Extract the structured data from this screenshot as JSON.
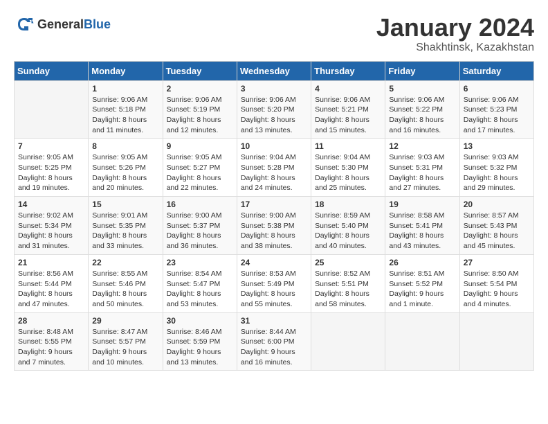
{
  "header": {
    "logo_general": "General",
    "logo_blue": "Blue",
    "title": "January 2024",
    "subtitle": "Shakhtinsk, Kazakhstan"
  },
  "days_of_week": [
    "Sunday",
    "Monday",
    "Tuesday",
    "Wednesday",
    "Thursday",
    "Friday",
    "Saturday"
  ],
  "weeks": [
    [
      {
        "day": "",
        "sunrise": "",
        "sunset": "",
        "daylight": ""
      },
      {
        "day": "1",
        "sunrise": "Sunrise: 9:06 AM",
        "sunset": "Sunset: 5:18 PM",
        "daylight": "Daylight: 8 hours and 11 minutes."
      },
      {
        "day": "2",
        "sunrise": "Sunrise: 9:06 AM",
        "sunset": "Sunset: 5:19 PM",
        "daylight": "Daylight: 8 hours and 12 minutes."
      },
      {
        "day": "3",
        "sunrise": "Sunrise: 9:06 AM",
        "sunset": "Sunset: 5:20 PM",
        "daylight": "Daylight: 8 hours and 13 minutes."
      },
      {
        "day": "4",
        "sunrise": "Sunrise: 9:06 AM",
        "sunset": "Sunset: 5:21 PM",
        "daylight": "Daylight: 8 hours and 15 minutes."
      },
      {
        "day": "5",
        "sunrise": "Sunrise: 9:06 AM",
        "sunset": "Sunset: 5:22 PM",
        "daylight": "Daylight: 8 hours and 16 minutes."
      },
      {
        "day": "6",
        "sunrise": "Sunrise: 9:06 AM",
        "sunset": "Sunset: 5:23 PM",
        "daylight": "Daylight: 8 hours and 17 minutes."
      }
    ],
    [
      {
        "day": "7",
        "sunrise": "Sunrise: 9:05 AM",
        "sunset": "Sunset: 5:25 PM",
        "daylight": "Daylight: 8 hours and 19 minutes."
      },
      {
        "day": "8",
        "sunrise": "Sunrise: 9:05 AM",
        "sunset": "Sunset: 5:26 PM",
        "daylight": "Daylight: 8 hours and 20 minutes."
      },
      {
        "day": "9",
        "sunrise": "Sunrise: 9:05 AM",
        "sunset": "Sunset: 5:27 PM",
        "daylight": "Daylight: 8 hours and 22 minutes."
      },
      {
        "day": "10",
        "sunrise": "Sunrise: 9:04 AM",
        "sunset": "Sunset: 5:28 PM",
        "daylight": "Daylight: 8 hours and 24 minutes."
      },
      {
        "day": "11",
        "sunrise": "Sunrise: 9:04 AM",
        "sunset": "Sunset: 5:30 PM",
        "daylight": "Daylight: 8 hours and 25 minutes."
      },
      {
        "day": "12",
        "sunrise": "Sunrise: 9:03 AM",
        "sunset": "Sunset: 5:31 PM",
        "daylight": "Daylight: 8 hours and 27 minutes."
      },
      {
        "day": "13",
        "sunrise": "Sunrise: 9:03 AM",
        "sunset": "Sunset: 5:32 PM",
        "daylight": "Daylight: 8 hours and 29 minutes."
      }
    ],
    [
      {
        "day": "14",
        "sunrise": "Sunrise: 9:02 AM",
        "sunset": "Sunset: 5:34 PM",
        "daylight": "Daylight: 8 hours and 31 minutes."
      },
      {
        "day": "15",
        "sunrise": "Sunrise: 9:01 AM",
        "sunset": "Sunset: 5:35 PM",
        "daylight": "Daylight: 8 hours and 33 minutes."
      },
      {
        "day": "16",
        "sunrise": "Sunrise: 9:00 AM",
        "sunset": "Sunset: 5:37 PM",
        "daylight": "Daylight: 8 hours and 36 minutes."
      },
      {
        "day": "17",
        "sunrise": "Sunrise: 9:00 AM",
        "sunset": "Sunset: 5:38 PM",
        "daylight": "Daylight: 8 hours and 38 minutes."
      },
      {
        "day": "18",
        "sunrise": "Sunrise: 8:59 AM",
        "sunset": "Sunset: 5:40 PM",
        "daylight": "Daylight: 8 hours and 40 minutes."
      },
      {
        "day": "19",
        "sunrise": "Sunrise: 8:58 AM",
        "sunset": "Sunset: 5:41 PM",
        "daylight": "Daylight: 8 hours and 43 minutes."
      },
      {
        "day": "20",
        "sunrise": "Sunrise: 8:57 AM",
        "sunset": "Sunset: 5:43 PM",
        "daylight": "Daylight: 8 hours and 45 minutes."
      }
    ],
    [
      {
        "day": "21",
        "sunrise": "Sunrise: 8:56 AM",
        "sunset": "Sunset: 5:44 PM",
        "daylight": "Daylight: 8 hours and 47 minutes."
      },
      {
        "day": "22",
        "sunrise": "Sunrise: 8:55 AM",
        "sunset": "Sunset: 5:46 PM",
        "daylight": "Daylight: 8 hours and 50 minutes."
      },
      {
        "day": "23",
        "sunrise": "Sunrise: 8:54 AM",
        "sunset": "Sunset: 5:47 PM",
        "daylight": "Daylight: 8 hours and 53 minutes."
      },
      {
        "day": "24",
        "sunrise": "Sunrise: 8:53 AM",
        "sunset": "Sunset: 5:49 PM",
        "daylight": "Daylight: 8 hours and 55 minutes."
      },
      {
        "day": "25",
        "sunrise": "Sunrise: 8:52 AM",
        "sunset": "Sunset: 5:51 PM",
        "daylight": "Daylight: 8 hours and 58 minutes."
      },
      {
        "day": "26",
        "sunrise": "Sunrise: 8:51 AM",
        "sunset": "Sunset: 5:52 PM",
        "daylight": "Daylight: 9 hours and 1 minute."
      },
      {
        "day": "27",
        "sunrise": "Sunrise: 8:50 AM",
        "sunset": "Sunset: 5:54 PM",
        "daylight": "Daylight: 9 hours and 4 minutes."
      }
    ],
    [
      {
        "day": "28",
        "sunrise": "Sunrise: 8:48 AM",
        "sunset": "Sunset: 5:55 PM",
        "daylight": "Daylight: 9 hours and 7 minutes."
      },
      {
        "day": "29",
        "sunrise": "Sunrise: 8:47 AM",
        "sunset": "Sunset: 5:57 PM",
        "daylight": "Daylight: 9 hours and 10 minutes."
      },
      {
        "day": "30",
        "sunrise": "Sunrise: 8:46 AM",
        "sunset": "Sunset: 5:59 PM",
        "daylight": "Daylight: 9 hours and 13 minutes."
      },
      {
        "day": "31",
        "sunrise": "Sunrise: 8:44 AM",
        "sunset": "Sunset: 6:00 PM",
        "daylight": "Daylight: 9 hours and 16 minutes."
      },
      {
        "day": "",
        "sunrise": "",
        "sunset": "",
        "daylight": ""
      },
      {
        "day": "",
        "sunrise": "",
        "sunset": "",
        "daylight": ""
      },
      {
        "day": "",
        "sunrise": "",
        "sunset": "",
        "daylight": ""
      }
    ]
  ]
}
